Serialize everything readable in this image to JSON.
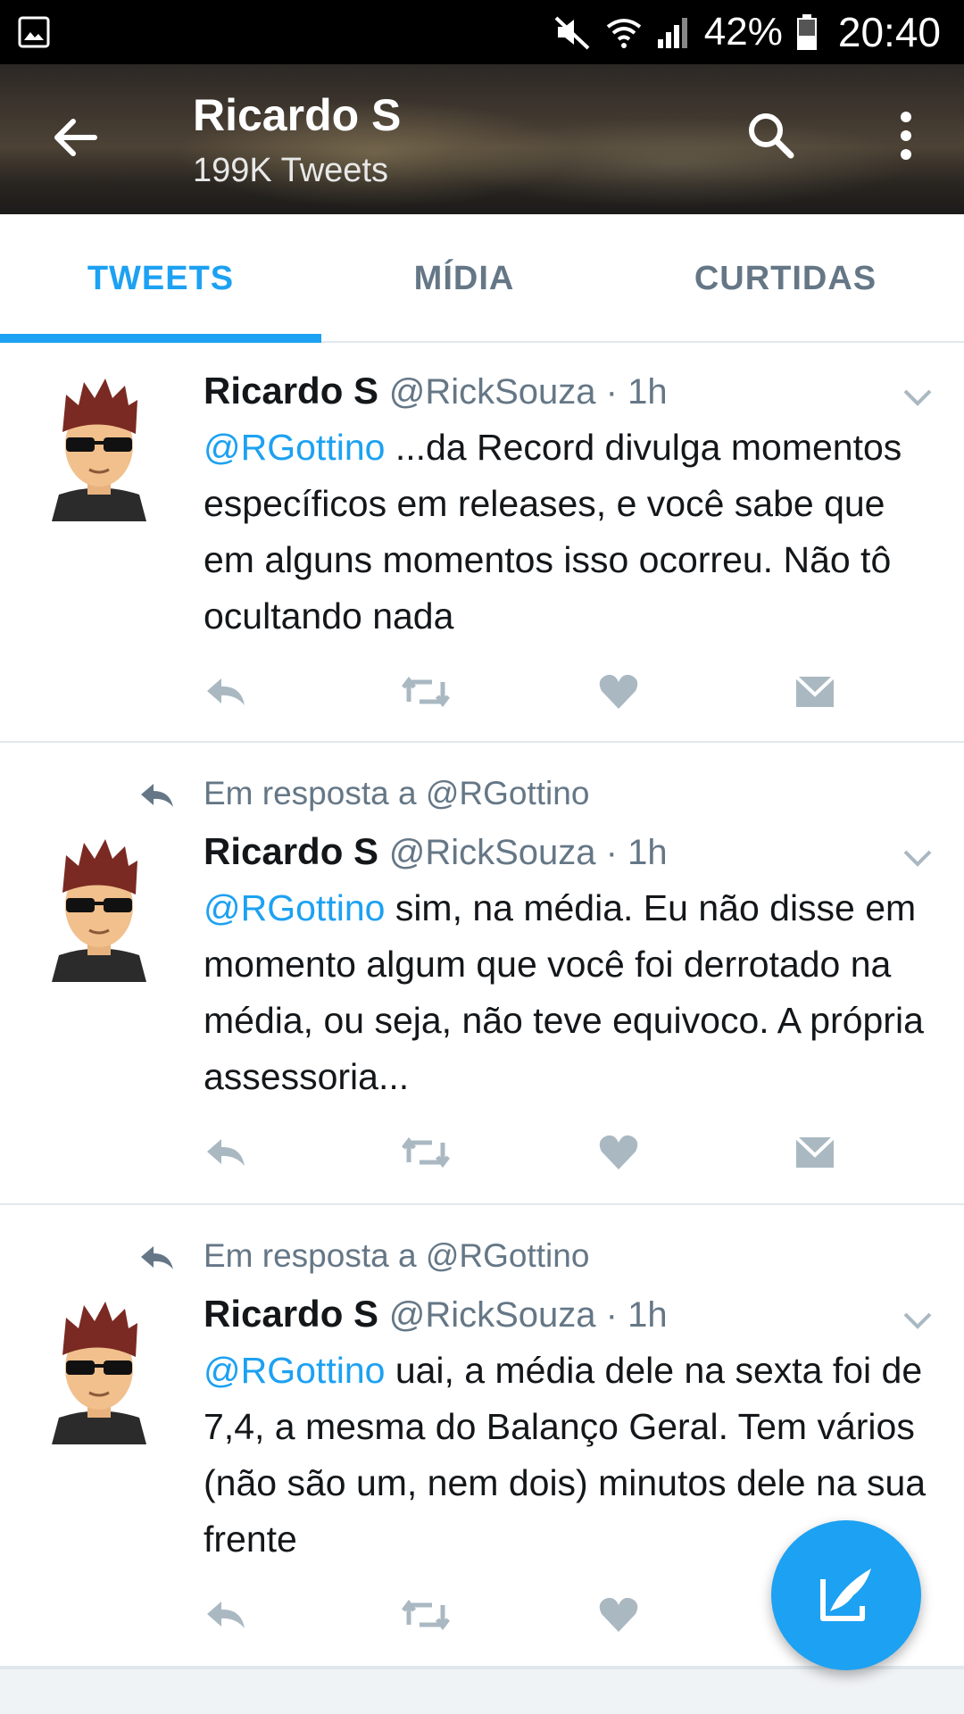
{
  "status_bar": {
    "battery": "42%",
    "time": "20:40",
    "icons": [
      "image-icon",
      "mute-icon",
      "wifi-icon",
      "signal-icon",
      "battery-icon"
    ]
  },
  "header": {
    "title": "Ricardo S",
    "subtitle": "199K Tweets"
  },
  "tabs": [
    {
      "label": "TWEETS",
      "active": true
    },
    {
      "label": "MÍDIA",
      "active": false
    },
    {
      "label": "CURTIDAS",
      "active": false
    }
  ],
  "tweets": [
    {
      "reply_context": "",
      "name": "Ricardo S",
      "meta": "@RickSouza · 1h",
      "mention": "@RGottino",
      "text": " ...da Record divulga momentos específicos em releases, e você sabe que em alguns momentos isso ocorreu. Não tô ocultando nada"
    },
    {
      "reply_context": "Em resposta a @RGottino",
      "name": "Ricardo S",
      "meta": "@RickSouza · 1h",
      "mention": "@RGottino",
      "text": " sim, na média. Eu não disse em momento algum que você foi derrotado na média, ou seja, não teve equivoco. A própria assessoria..."
    },
    {
      "reply_context": "Em resposta a @RGottino",
      "name": "Ricardo S",
      "meta": "@RickSouza · 1h",
      "mention": "@RGottino",
      "text": " uai, a média dele na sexta foi de 7,4, a mesma do Balanço Geral. Tem vários (não são um, nem dois) minutos dele na sua frente"
    }
  ],
  "colors": {
    "accent": "#1da1f2",
    "secondary_text": "#657786",
    "icon_gray": "#aab8c2"
  }
}
